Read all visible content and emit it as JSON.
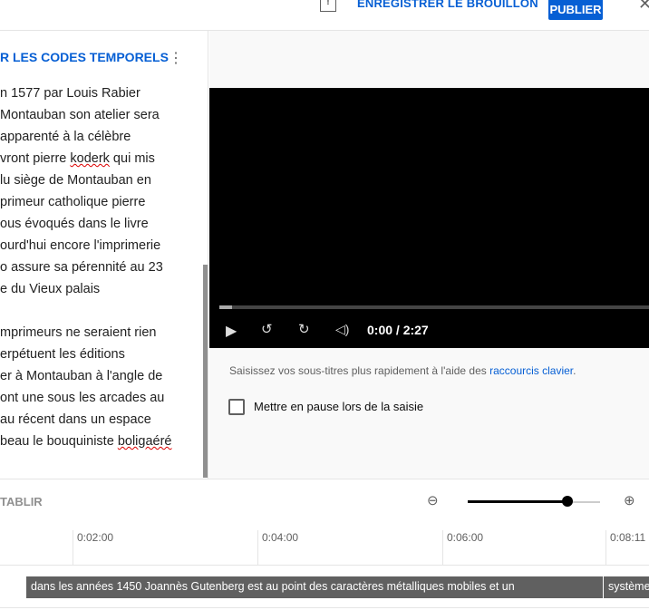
{
  "header": {
    "save_draft": "ENREGISTRER LE BROUILLON",
    "publish": "PUBLIER",
    "close_icon": "close-icon",
    "flag_icon": "feedback-icon"
  },
  "editor": {
    "timestamps_button": "R LES CODES TEMPORELS",
    "more_icon": "more-vert-icon",
    "lines": [
      "n 1577 par Louis Rabier",
      " Montauban son atelier sera",
      " apparenté à la célèbre",
      "vront pierre koderk qui mis",
      "lu siège de Montauban en",
      "primeur catholique pierre",
      "ous évoqués dans le livre",
      "ourd'hui encore l'imprimerie",
      "o assure sa pérennité au 23",
      "e du Vieux palais",
      "",
      "mprimeurs ne seraient rien",
      "erpétuent les éditions",
      "er à Montauban à l'angle de",
      "ont une sous les arcades au",
      "au récent dans un espace",
      "beau le bouquiniste boligaéré"
    ]
  },
  "player": {
    "time": "0:00 / 2:27",
    "progress": 0.03
  },
  "hint": {
    "text": "Saisissez vos sous-titres plus rapidement à l'aide des ",
    "link": "raccourcis clavier",
    "end": "."
  },
  "pause_checkbox": {
    "label": "Mettre en pause lors de la saisie",
    "checked": false
  },
  "timeline": {
    "restore": "TABLIR",
    "zoom_level": 0.75,
    "ticks": [
      "0:02:00",
      "0:04:00",
      "0:06:00",
      "0:08:11"
    ],
    "captions": [
      "dans les années 1450 Joannès Gutenberg est au  point des caractères métalliques mobiles et un",
      "système"
    ]
  }
}
